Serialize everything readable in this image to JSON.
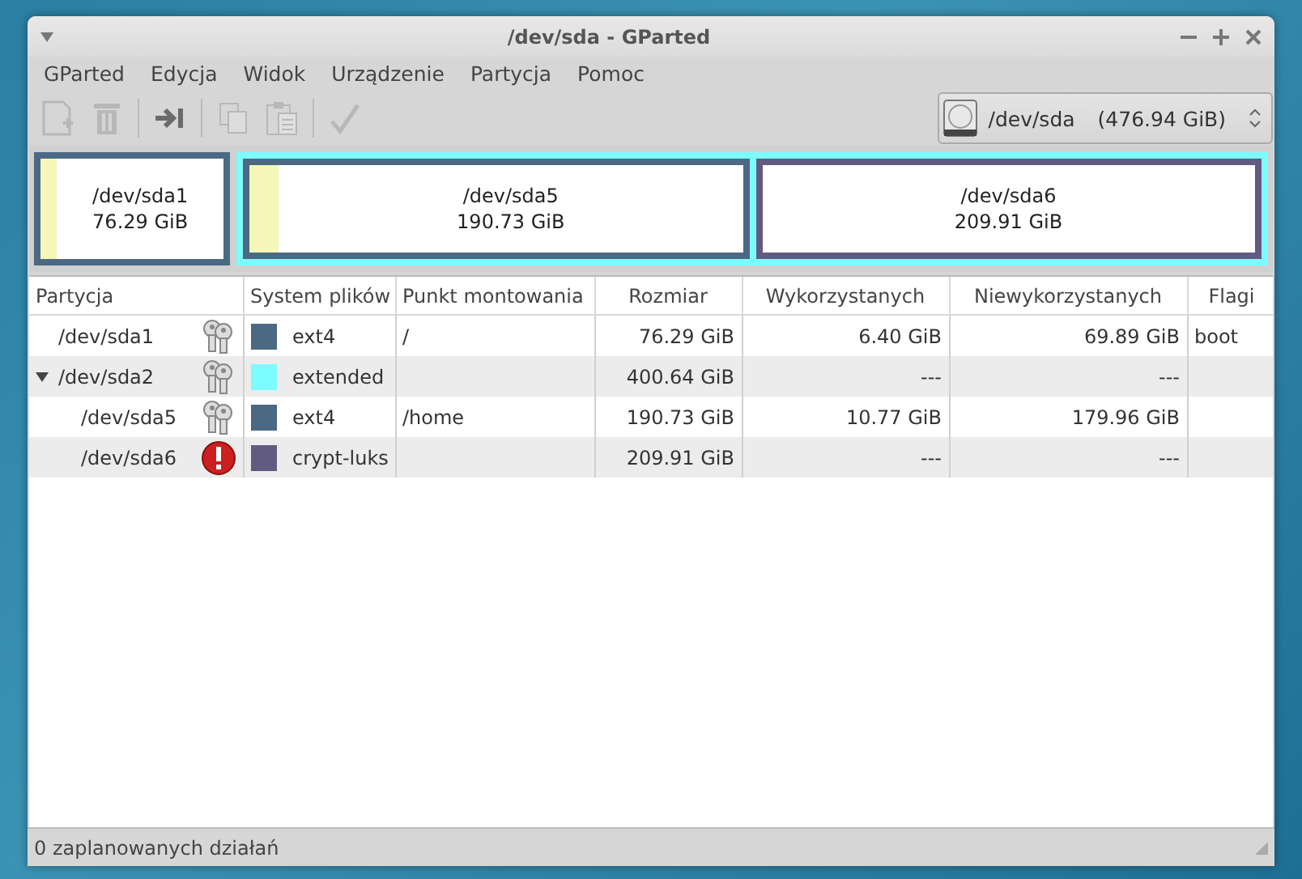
{
  "window": {
    "title": "/dev/sda - GParted"
  },
  "menu": [
    "GParted",
    "Edycja",
    "Widok",
    "Urządzenie",
    "Partycja",
    "Pomoc"
  ],
  "toolbar": [
    {
      "kind": "new",
      "disabled": true
    },
    {
      "kind": "delete",
      "disabled": true
    },
    {
      "kind": "sep"
    },
    {
      "kind": "resize",
      "disabled": false
    },
    {
      "kind": "sep"
    },
    {
      "kind": "copy",
      "disabled": true
    },
    {
      "kind": "paste",
      "disabled": true
    },
    {
      "kind": "sep"
    },
    {
      "kind": "apply",
      "disabled": true
    }
  ],
  "device": {
    "name": "/dev/sda",
    "size": "(476.94 GiB)"
  },
  "graph": [
    {
      "kind": "primary",
      "name": "/dev/sda1",
      "size": "76.29 GiB",
      "color": "#4b6983",
      "level": 0.09
    },
    {
      "kind": "extended",
      "color": "#7dfcfe",
      "children": [
        {
          "kind": "primary",
          "name": "/dev/sda5",
          "size": "190.73 GiB",
          "color": "#4b6983",
          "level": 0.06
        },
        {
          "kind": "primary",
          "name": "/dev/sda6",
          "size": "209.91 GiB",
          "color": "#625b81"
        }
      ]
    }
  ],
  "table": {
    "columns": [
      "Partycja",
      "System plików",
      "Punkt montowania",
      "Rozmiar",
      "Wykorzystanych",
      "Niewykorzystanych",
      "Flagi"
    ],
    "rows": [
      {
        "partition": "/dev/sda1",
        "kind": "mounted",
        "filesystem": "ext4",
        "color": "#4b6983",
        "mount": "/",
        "size": "76.29 GiB",
        "used": "6.40 GiB",
        "unused": "69.89 GiB",
        "flags": "boot"
      },
      {
        "partition": "/dev/sda2",
        "kind": "mounted",
        "filesystem": "extended",
        "color": "#7dfcfe",
        "size": "400.64 GiB",
        "used": "---",
        "unused": "---",
        "expanded": true,
        "children": [
          {
            "partition": "/dev/sda5",
            "kind": "mounted",
            "filesystem": "ext4",
            "color": "#4b6983",
            "mount": "/home",
            "size": "190.73 GiB",
            "used": "10.77 GiB",
            "unused": "179.96 GiB"
          },
          {
            "partition": "/dev/sda6",
            "kind": "error",
            "filesystem": "crypt-luks",
            "color": "#625b81",
            "size": "209.91 GiB",
            "used": "---",
            "unused": "---"
          }
        ]
      }
    ]
  },
  "status_bar": "0 zaplanowanych działań"
}
